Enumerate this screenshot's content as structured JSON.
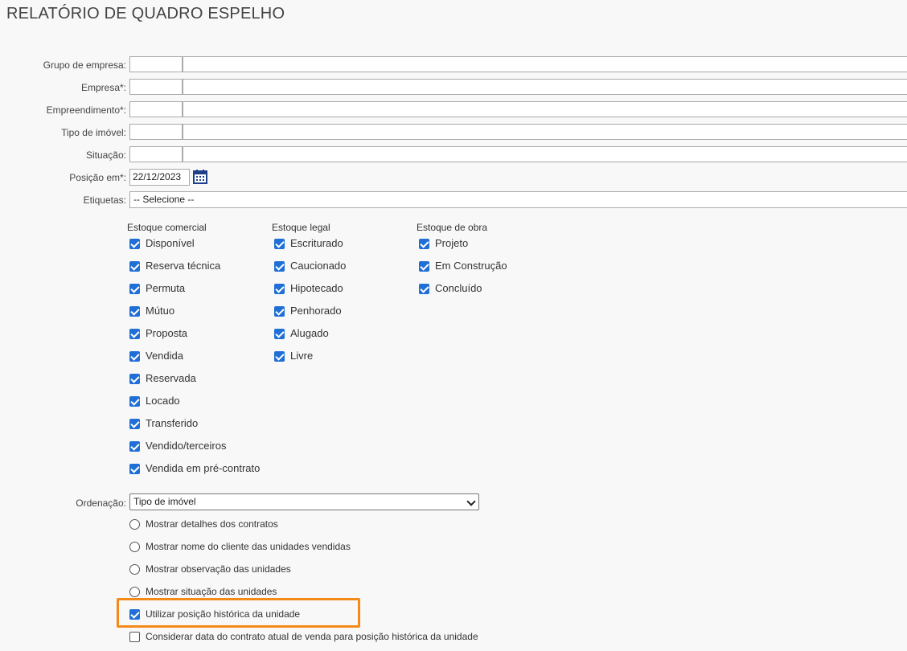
{
  "page": {
    "title": "RELATÓRIO DE QUADRO ESPELHO"
  },
  "filters": {
    "grupo_empresa_label": "Grupo de empresa:",
    "empresa_label": "Empresa*:",
    "empreendimento_label": "Empreendimento*:",
    "tipo_imovel_label": "Tipo de imóvel:",
    "situacao_label": "Situação:",
    "posicao_label": "Posição em*:",
    "posicao_value": "22/12/2023",
    "etiquetas_label": "Etiquetas:",
    "etiquetas_value": "-- Selecione --"
  },
  "estoque": {
    "comercial": {
      "header": "Estoque comercial",
      "items": [
        "Disponível",
        "Reserva técnica",
        "Permuta",
        "Mútuo",
        "Proposta",
        "Vendida",
        "Reservada",
        "Locado",
        "Transferido",
        "Vendido/terceiros",
        "Vendida em pré-contrato"
      ]
    },
    "legal": {
      "header": "Estoque legal",
      "items": [
        "Escriturado",
        "Caucionado",
        "Hipotecado",
        "Penhorado",
        "Alugado",
        "Livre"
      ]
    },
    "obra": {
      "header": "Estoque de obra",
      "items": [
        "Projeto",
        "Em Construção",
        "Concluído"
      ]
    }
  },
  "ordenacao": {
    "label": "Ordenação:",
    "value": "Tipo de imóvel"
  },
  "options": {
    "detalhes_contratos": "Mostrar detalhes dos contratos",
    "nome_cliente": "Mostrar nome do cliente das unidades vendidas",
    "observacao": "Mostrar observação das unidades",
    "situacao": "Mostrar situação das unidades",
    "posicao_historica": "Utilizar posição histórica da unidade",
    "data_contrato": "Considerar data do contrato atual de venda para posição histórica da unidade"
  },
  "colors": {
    "accent": "#1f6fd6",
    "highlight": "#f48a17"
  },
  "icons": {
    "date_picker": "calendar-icon",
    "dropdown": "chevron-down-icon"
  }
}
